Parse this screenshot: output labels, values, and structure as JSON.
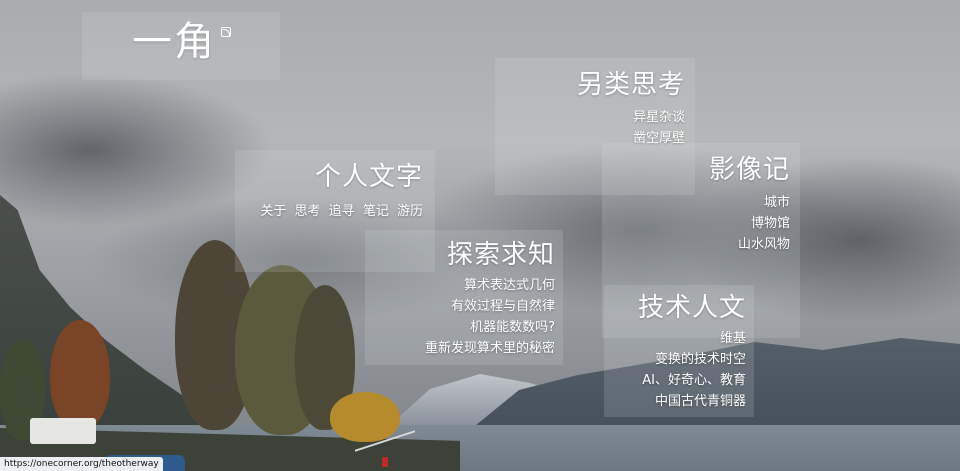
{
  "site": {
    "title": "一角",
    "rss_icon": "rss-icon"
  },
  "sections": {
    "personal": {
      "title": "个人文字",
      "links": [
        "关于",
        "思考",
        "追寻",
        "笔记",
        "游历"
      ]
    },
    "alt": {
      "title": "另类思考",
      "links": [
        "异星杂谈",
        "凿空厚壁"
      ]
    },
    "image": {
      "title": "影像记",
      "links": [
        "城市",
        "博物馆",
        "山水风物"
      ]
    },
    "explore": {
      "title": "探索求知",
      "links": [
        "算术表达式几何",
        "有效过程与自然律",
        "机器能数数吗?",
        "重新发现算术里的秘密"
      ]
    },
    "tech": {
      "title": "技术人文",
      "links": [
        "维基",
        "变换的技术时空",
        "AI、好奇心、教育",
        "中国古代青铜器"
      ]
    }
  },
  "status_bar": {
    "url": "https://onecorner.org/theotherway"
  }
}
